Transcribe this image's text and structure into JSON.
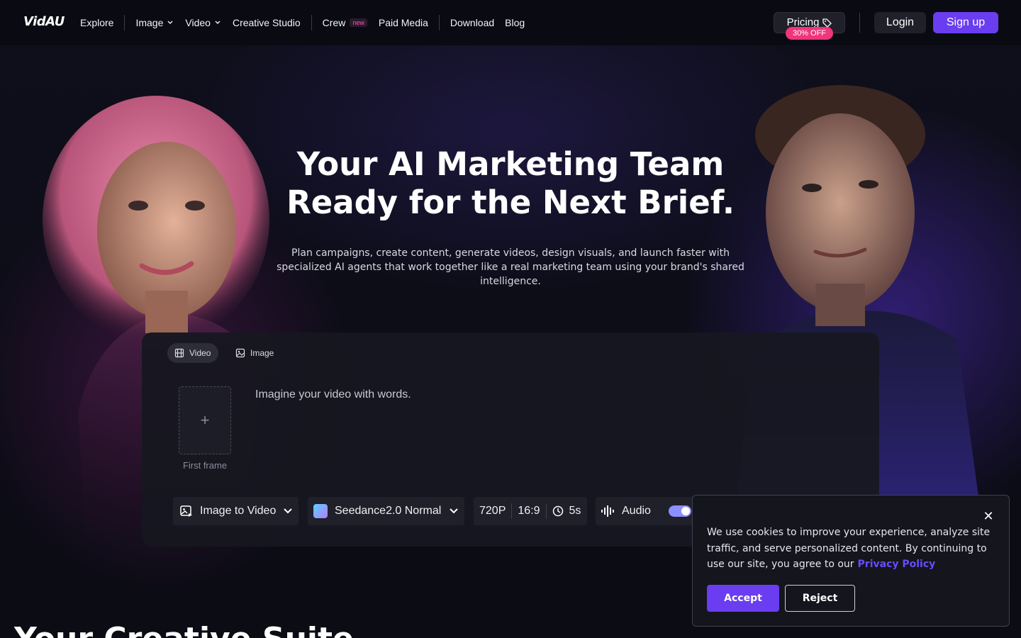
{
  "nav": {
    "logo": "VidAU",
    "items": [
      {
        "label": "Explore"
      },
      {
        "label": "Image"
      },
      {
        "label": "Video"
      },
      {
        "label": "Creative Studio"
      },
      {
        "label": "Crew",
        "badge": "new"
      },
      {
        "label": "Paid Media"
      },
      {
        "label": "Download"
      },
      {
        "label": "Blog"
      }
    ],
    "pricing_label": "Pricing",
    "pricing_badge": "30% OFF",
    "login_label": "Login",
    "signup_label": "Sign up"
  },
  "hero": {
    "headline_line1": "Your AI Marketing Team",
    "headline_line2": "Ready for the Next Brief.",
    "subtitle": "Plan campaigns, create content, generate videos, design visuals, and launch faster with specialized AI agents that work together like a real marketing team using your brand's shared intelligence."
  },
  "composer": {
    "tabs": [
      {
        "label": "Video",
        "icon": "film-icon",
        "active": true
      },
      {
        "label": "Image",
        "icon": "image-icon",
        "active": false
      }
    ],
    "frame_label": "First frame",
    "prompt_placeholder": "Imagine your video with words.",
    "mode_select": "Image to Video",
    "model_select": "Seedance2.0 Normal",
    "resolution": "720P",
    "aspect_ratio": "16:9",
    "duration": "5s",
    "audio_label": "Audio",
    "audio_enabled": true
  },
  "next_section_title": "Your Creative Suite",
  "cookie": {
    "text": "We use cookies to improve your experience, analyze site traffic, and serve personalized content. By continuing to use our site, you agree to our",
    "link_label": "Privacy Policy",
    "accept_label": "Accept",
    "reject_label": "Reject"
  },
  "colors": {
    "accent": "#6a3df0",
    "badge": "#f0357c",
    "new_badge": "#ff4fb4",
    "link": "#6a4bff"
  }
}
